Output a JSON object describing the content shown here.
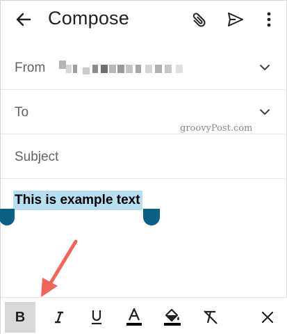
{
  "appbar": {
    "title": "Compose",
    "back_icon": "arrow-back-icon",
    "attach_icon": "paperclip-icon",
    "send_icon": "send-icon",
    "more_icon": "more-vert-icon"
  },
  "fields": {
    "from_label": "From",
    "to_label": "To",
    "subject_placeholder": "Subject"
  },
  "watermark": "groovyPost.com",
  "body": {
    "selected_text": "This is example text"
  },
  "toolbar": {
    "bold_label": "B",
    "items": [
      "bold-icon",
      "italic-icon",
      "underline-icon",
      "text-color-icon",
      "fill-color-icon",
      "clear-format-icon",
      "close-icon"
    ]
  },
  "colors": {
    "selection": "#b9ddf3",
    "handle": "#0b6183",
    "arrow": "#f0655a",
    "active_button": "#d9d9d9"
  }
}
